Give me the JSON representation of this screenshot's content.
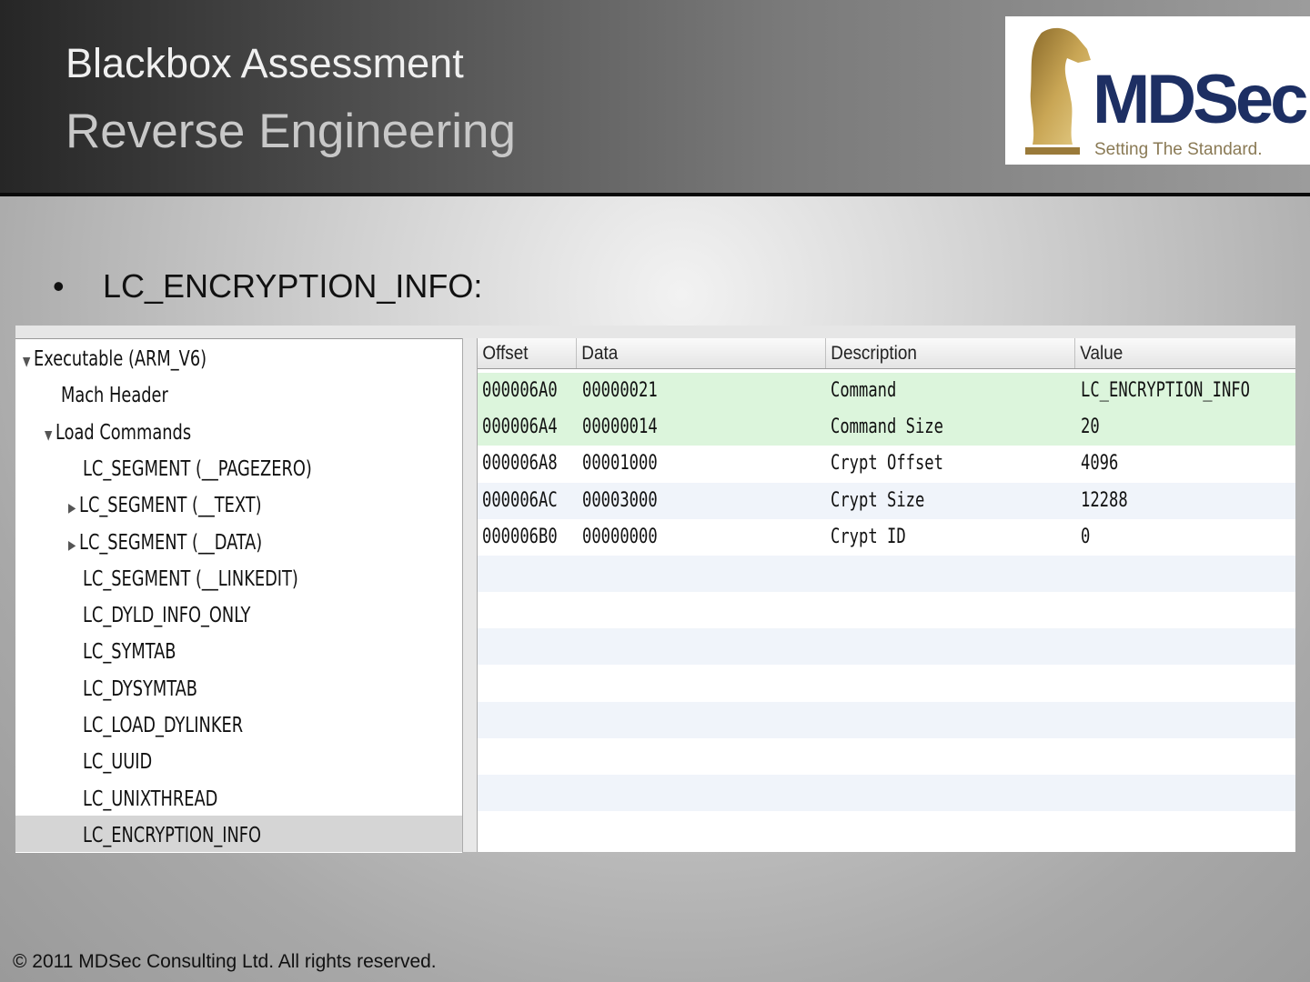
{
  "header": {
    "title": "Blackbox Assessment",
    "subtitle": "Reverse Engineering"
  },
  "logo": {
    "name": "MDSec",
    "tagline": "Setting The Standard."
  },
  "bullet": {
    "marker": "•",
    "text": "LC_ENCRYPTION_INFO:"
  },
  "tree": {
    "items": [
      {
        "label": "Executable  (ARM_V6)",
        "expander": "▼"
      },
      {
        "label": "Mach Header",
        "expander": ""
      },
      {
        "label": "Load Commands",
        "expander": "▼"
      },
      {
        "label": "LC_SEGMENT (__PAGEZERO)",
        "expander": ""
      },
      {
        "label": "LC_SEGMENT (__TEXT)",
        "expander": "▶"
      },
      {
        "label": "LC_SEGMENT (__DATA)",
        "expander": "▶"
      },
      {
        "label": "LC_SEGMENT (__LINKEDIT)",
        "expander": ""
      },
      {
        "label": "LC_DYLD_INFO_ONLY",
        "expander": ""
      },
      {
        "label": "LC_SYMTAB",
        "expander": ""
      },
      {
        "label": "LC_DYSYMTAB",
        "expander": ""
      },
      {
        "label": "LC_LOAD_DYLINKER",
        "expander": ""
      },
      {
        "label": "LC_UUID",
        "expander": ""
      },
      {
        "label": "LC_UNIXTHREAD",
        "expander": ""
      },
      {
        "label": "LC_ENCRYPTION_INFO",
        "expander": ""
      }
    ],
    "selected": "LC_ENCRYPTION_INFO"
  },
  "table": {
    "columns": [
      "Offset",
      "Data",
      "Description",
      "Value"
    ],
    "rows": [
      {
        "offset": "000006A0",
        "data": "00000021",
        "description": "Command",
        "value": "LC_ENCRYPTION_INFO"
      },
      {
        "offset": "000006A4",
        "data": "00000014",
        "description": "Command Size",
        "value": "20"
      },
      {
        "offset": "000006A8",
        "data": "00001000",
        "description": "Crypt Offset",
        "value": "4096"
      },
      {
        "offset": "000006AC",
        "data": "00003000",
        "description": "Crypt Size",
        "value": "12288"
      },
      {
        "offset": "000006B0",
        "data": "00000000",
        "description": "Crypt ID",
        "value": "0"
      }
    ],
    "highlight_color": "#dcf5dc",
    "alt_row_color": "#f0f4fa"
  },
  "footer": {
    "text": "© 2011 MDSec Consulting Ltd.  All rights reserved."
  }
}
